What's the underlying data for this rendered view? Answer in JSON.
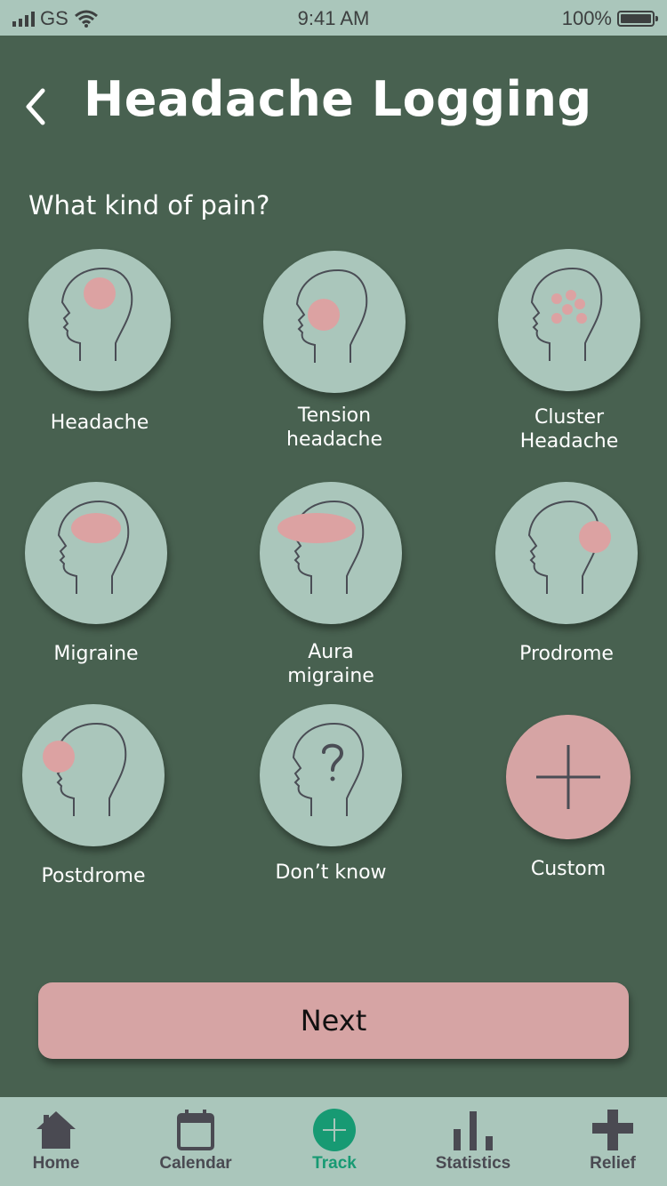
{
  "status_bar": {
    "carrier": "GS",
    "time": "9:41 AM",
    "battery": "100%"
  },
  "header": {
    "title": "Headache Logging"
  },
  "question": "What kind of pain?",
  "options": [
    {
      "line1": "Headache",
      "line2": "",
      "icon": "headache-head-icon"
    },
    {
      "line1": "Tension",
      "line2": "headache",
      "icon": "tension-head-icon"
    },
    {
      "line1": "Cluster",
      "line2": "Headache",
      "icon": "cluster-head-icon"
    },
    {
      "line1": "Migraine",
      "line2": "",
      "icon": "migraine-head-icon"
    },
    {
      "line1": "Aura",
      "line2": "migraine",
      "icon": "aura-head-icon"
    },
    {
      "line1": "Prodrome",
      "line2": "",
      "icon": "prodrome-head-icon"
    },
    {
      "line1": "Postdrome",
      "line2": "",
      "icon": "postdrome-head-icon"
    },
    {
      "line1": "Don’t know",
      "line2": "",
      "icon": "question-head-icon"
    },
    {
      "line1": "Custom",
      "line2": "",
      "icon": "plus-icon"
    }
  ],
  "next_button": {
    "label": "Next"
  },
  "tabs": [
    {
      "label": "Home",
      "icon": "home-icon",
      "active": false
    },
    {
      "label": "Calendar",
      "icon": "calendar-icon",
      "active": false
    },
    {
      "label": "Track",
      "icon": "track-plus-icon",
      "active": true
    },
    {
      "label": "Statistics",
      "icon": "bar-chart-icon",
      "active": false
    },
    {
      "label": "Relief",
      "icon": "cross-icon",
      "active": false
    }
  ],
  "colors": {
    "background": "#486150",
    "mint": "#aac6bb",
    "pink": "#d6a4a4",
    "pain_spot": "#dca2a2",
    "active_tab": "#179a73",
    "tab_inactive": "#4a4a52"
  }
}
